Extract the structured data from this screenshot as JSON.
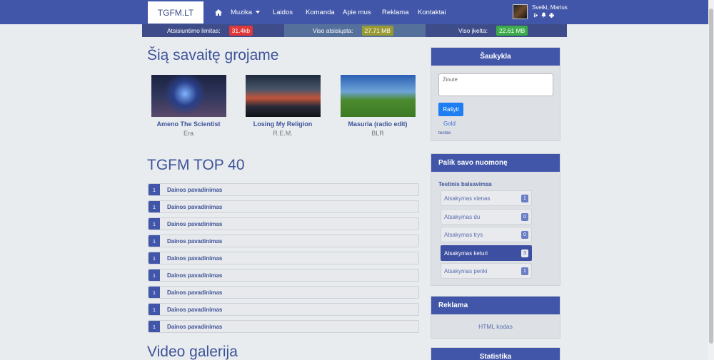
{
  "navbar": {
    "brand": "TGFM.LT",
    "items": [
      {
        "label": "Muzika"
      },
      {
        "label": "Laidos"
      },
      {
        "label": "Komanda"
      },
      {
        "label": "Apie mus"
      },
      {
        "label": "Reklama"
      },
      {
        "label": "Kontaktai"
      }
    ],
    "user": {
      "name": "Sveiki, Marius"
    },
    "icons": [
      "home-icon",
      "caret-down-icon",
      "logout-icon",
      "bell-icon",
      "gear-icon"
    ]
  },
  "stats": [
    {
      "label": "Atsisiuntimo limitas:",
      "value": "31.4kb",
      "color": "#e0383a"
    },
    {
      "label": "Viso atsisiųsta:",
      "value": "27.71 MB",
      "color": "#9a9a34"
    },
    {
      "label": "Viso įkelta:",
      "value": "22.61 MB",
      "color": "#3cab4a"
    }
  ],
  "featured": {
    "heading": "Šią savaitę grojame",
    "songs": [
      {
        "title": "Ameno The Scientist",
        "artist": "Era"
      },
      {
        "title": "Losing My Religion",
        "artist": "R.E.M."
      },
      {
        "title": "Masuria (radio edit)",
        "artist": "BLR"
      }
    ]
  },
  "top40": {
    "heading": "TGFM TOP 40",
    "rows": [
      {
        "num": "1",
        "title": "Dainos pavadinimas"
      },
      {
        "num": "1",
        "title": "Dainos pavadinimas"
      },
      {
        "num": "1",
        "title": "Dainos pavadinimas"
      },
      {
        "num": "1",
        "title": "Dainos pavadinimas"
      },
      {
        "num": "1",
        "title": "Dainos pavadinimas"
      },
      {
        "num": "1",
        "title": "Dainos pavadinimas"
      },
      {
        "num": "1",
        "title": "Dainos pavadinimas"
      },
      {
        "num": "1",
        "title": "Dainos pavadinimas"
      },
      {
        "num": "1",
        "title": "Dainos pavadinimas"
      }
    ]
  },
  "video": {
    "heading": "Video galerija"
  },
  "shoutbox": {
    "title": "Šaukykla",
    "placeholder": "Žinutė",
    "button": "Rašyti",
    "user": "Gold",
    "message": "testas"
  },
  "poll": {
    "title": "Palik savo nuomonę",
    "question": "Testinis balsavimas",
    "options": [
      {
        "label": "Atsakymas vienas",
        "count": "1",
        "active": false
      },
      {
        "label": "Atsakymas du",
        "count": "0",
        "active": false
      },
      {
        "label": "Atsakymas trys",
        "count": "0",
        "active": false
      },
      {
        "label": "Atsakymas keturi",
        "count": "3",
        "active": true
      },
      {
        "label": "Atsakymas penki",
        "count": "1",
        "active": false
      }
    ]
  },
  "ad": {
    "title": "Reklama",
    "text": "HTML kodas"
  },
  "stats_card": {
    "title": "Statistika"
  },
  "colors": {
    "primary": "#4156a8",
    "page_bg": "#e9ecef",
    "accent_text": "#3d5399"
  }
}
